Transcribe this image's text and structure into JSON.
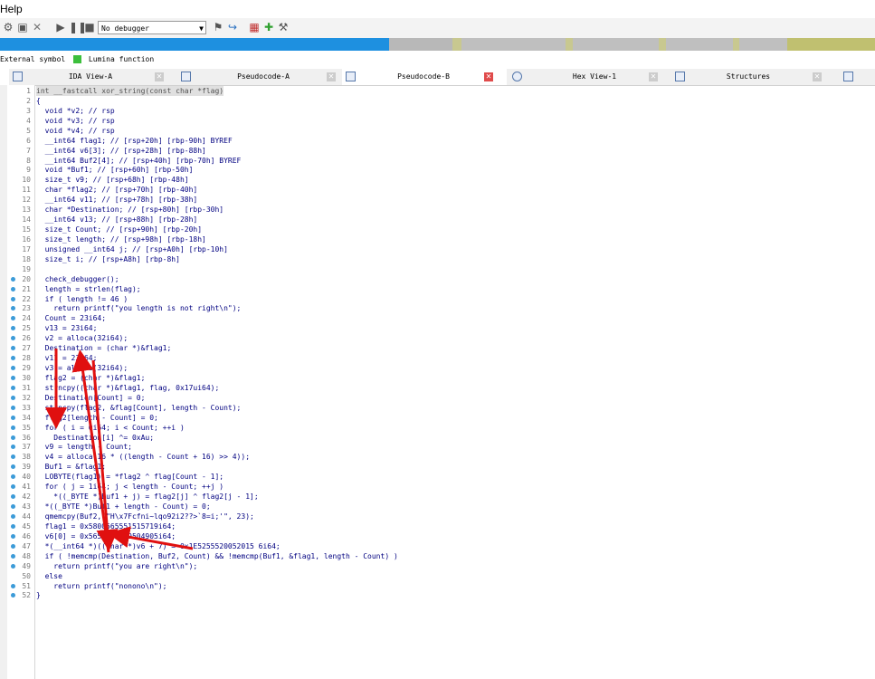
{
  "menu": {
    "help_label": "Help"
  },
  "toolbar": {
    "debugger_select": "No debugger"
  },
  "legend": {
    "external_label": "External symbol",
    "lumina_label": "Lumina function",
    "lumina_color": "#3cbf3c"
  },
  "tabs": [
    {
      "label": "IDA View-A",
      "active": false
    },
    {
      "label": "Pseudocode-A",
      "active": false
    },
    {
      "label": "Pseudocode-B",
      "active": true
    },
    {
      "label": "Hex View-1",
      "active": false
    },
    {
      "label": "Structures",
      "active": false
    }
  ],
  "code": {
    "lines": [
      {
        "n": "1",
        "dot": false,
        "t": "int __fastcall xor_string(const char *flag)"
      },
      {
        "n": "2",
        "dot": false,
        "t": "{"
      },
      {
        "n": "3",
        "dot": false,
        "t": "  void *v2; // rsp"
      },
      {
        "n": "4",
        "dot": false,
        "t": "  void *v3; // rsp"
      },
      {
        "n": "5",
        "dot": false,
        "t": "  void *v4; // rsp"
      },
      {
        "n": "6",
        "dot": false,
        "t": "  __int64 flag1; // [rsp+20h] [rbp-90h] BYREF"
      },
      {
        "n": "7",
        "dot": false,
        "t": "  __int64 v6[3]; // [rsp+28h] [rbp-88h]"
      },
      {
        "n": "8",
        "dot": false,
        "t": "  __int64 Buf2[4]; // [rsp+40h] [rbp-70h] BYREF"
      },
      {
        "n": "9",
        "dot": false,
        "t": "  void *Buf1; // [rsp+60h] [rbp-50h]"
      },
      {
        "n": "10",
        "dot": false,
        "t": "  size_t v9; // [rsp+68h] [rbp-48h]"
      },
      {
        "n": "11",
        "dot": false,
        "t": "  char *flag2; // [rsp+70h] [rbp-40h]"
      },
      {
        "n": "12",
        "dot": false,
        "t": "  __int64 v11; // [rsp+78h] [rbp-38h]"
      },
      {
        "n": "13",
        "dot": false,
        "t": "  char *Destination; // [rsp+80h] [rbp-30h]"
      },
      {
        "n": "14",
        "dot": false,
        "t": "  __int64 v13; // [rsp+88h] [rbp-28h]"
      },
      {
        "n": "15",
        "dot": false,
        "t": "  size_t Count; // [rsp+90h] [rbp-20h]"
      },
      {
        "n": "16",
        "dot": false,
        "t": "  size_t length; // [rsp+98h] [rbp-18h]"
      },
      {
        "n": "17",
        "dot": false,
        "t": "  unsigned __int64 j; // [rsp+A0h] [rbp-10h]"
      },
      {
        "n": "18",
        "dot": false,
        "t": "  size_t i; // [rsp+A8h] [rbp-8h]"
      },
      {
        "n": "19",
        "dot": false,
        "t": ""
      },
      {
        "n": "20",
        "dot": true,
        "t": "  check_debugger();"
      },
      {
        "n": "21",
        "dot": true,
        "t": "  length = strlen(flag);"
      },
      {
        "n": "22",
        "dot": true,
        "t": "  if ( length != 46 )"
      },
      {
        "n": "23",
        "dot": true,
        "t": "    return printf(\"you length is not right\\n\");"
      },
      {
        "n": "24",
        "dot": true,
        "t": "  Count = 23i64;"
      },
      {
        "n": "25",
        "dot": true,
        "t": "  v13 = 23i64;"
      },
      {
        "n": "26",
        "dot": true,
        "t": "  v2 = alloca(32i64);"
      },
      {
        "n": "27",
        "dot": true,
        "t": "  Destination = (char *)&flag1;"
      },
      {
        "n": "28",
        "dot": true,
        "t": "  v11 = 23i64;"
      },
      {
        "n": "29",
        "dot": true,
        "t": "  v3 = alloca(32i64);"
      },
      {
        "n": "30",
        "dot": true,
        "t": "  flag2 = (char *)&flag1;"
      },
      {
        "n": "31",
        "dot": true,
        "t": "  strncpy((char *)&flag1, flag, 0x17ui64);"
      },
      {
        "n": "32",
        "dot": true,
        "t": "  Destination[Count] = 0;"
      },
      {
        "n": "33",
        "dot": true,
        "t": "  strncpy(flag2, &flag[Count], length - Count);"
      },
      {
        "n": "34",
        "dot": true,
        "t": "  flag2[length - Count] = 0;"
      },
      {
        "n": "35",
        "dot": true,
        "t": "  for ( i = 0i64; i < Count; ++i )"
      },
      {
        "n": "36",
        "dot": true,
        "t": "    Destination[i] ^= 0xAu;"
      },
      {
        "n": "37",
        "dot": true,
        "t": "  v9 = length - Count;"
      },
      {
        "n": "38",
        "dot": true,
        "t": "  v4 = alloca(16 * ((length - Count + 16) >> 4));"
      },
      {
        "n": "39",
        "dot": true,
        "t": "  Buf1 = &flag1;"
      },
      {
        "n": "40",
        "dot": true,
        "t": "  LOBYTE(flag1) = *flag2 ^ flag[Count - 1];"
      },
      {
        "n": "41",
        "dot": true,
        "t": "  for ( j = 1i64; j < length - Count; ++j )"
      },
      {
        "n": "42",
        "dot": true,
        "t": "    *((_BYTE *)Buf1 + j) = flag2[j] ^ flag2[j - 1];"
      },
      {
        "n": "43",
        "dot": true,
        "t": "  *((_BYTE *)Buf1 + length - Count) = 0;"
      },
      {
        "n": "44",
        "dot": true,
        "t": "  qmemcpy(Buf2, \"H\\x7Fcfni~lqo92i2??>`8=i;'\", 23);"
      },
      {
        "n": "45",
        "dot": true,
        "t": "  flag1 = 0x5800565551515719i64;"
      },
      {
        "n": "46",
        "dot": true,
        "t": "  v6[0] = 0x5657525759504905i64;"
      },
      {
        "n": "47",
        "dot": true,
        "t": "  *(__int64 *)((char *)v6 + 7) = 0x1E5255520052015 6i64;"
      },
      {
        "n": "48",
        "dot": true,
        "t": "  if ( !memcmp(Destination, Buf2, Count) && !memcmp(Buf1, &flag1, length - Count) )"
      },
      {
        "n": "49",
        "dot": true,
        "t": "    return printf(\"you are right\\n\");"
      },
      {
        "n": "50",
        "dot": false,
        "t": "  else"
      },
      {
        "n": "51",
        "dot": true,
        "t": "    return printf(\"nonono\\n\");"
      },
      {
        "n": "52",
        "dot": true,
        "t": "}"
      }
    ]
  },
  "annotation": {
    "arrow_color": "#e01010"
  }
}
